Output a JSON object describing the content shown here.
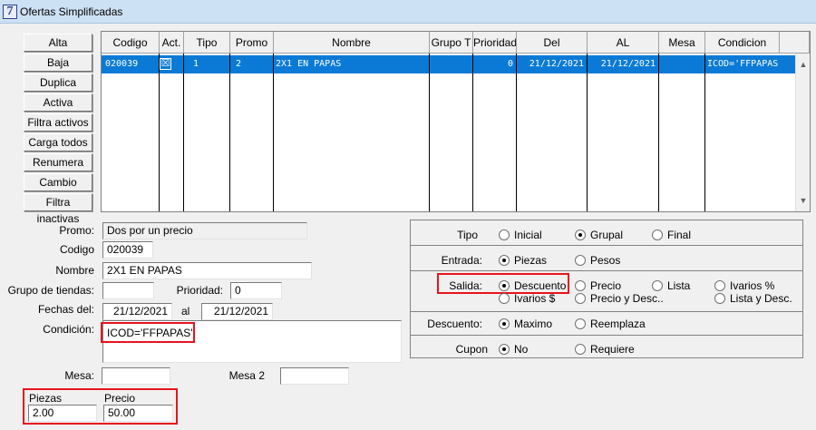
{
  "window": {
    "title": "Ofertas Simplificadas",
    "icon": "7"
  },
  "buttons": [
    "Alta",
    "Baja",
    "Duplica",
    "Activa",
    "Filtra activos",
    "Carga todos",
    "Renumera",
    "Cambio",
    "Filtra inactivas"
  ],
  "grid": {
    "headers": [
      "Codigo",
      "Act.",
      "Tipo",
      "Promo",
      "Nombre",
      "Grupo T",
      "Prioridad",
      "Del",
      "AL",
      "Mesa",
      "Condicion"
    ],
    "row": {
      "codigo": "020039",
      "act": "☒",
      "tipo": "1",
      "promo": "2",
      "nombre": "2X1 EN PAPAS",
      "grupo": "",
      "prioridad": "0",
      "del": "21/12/2021",
      "al": "21/12/2021",
      "mesa": "",
      "condicion": "ICOD='FFPAPAS"
    }
  },
  "form": {
    "promo_label": "Promo:",
    "promo_value": "Dos por un precio",
    "codigo_label": "Codigo",
    "codigo_value": "020039",
    "nombre_label": "Nombre",
    "nombre_value": "2X1 EN PAPAS",
    "grupo_label": "Grupo de tiendas:",
    "grupo_value": "",
    "prioridad_label": "Prioridad:",
    "prioridad_value": "0",
    "fechas_label": "Fechas del:",
    "fecha_del": "21/12/2021",
    "al_label": "al",
    "fecha_al": "21/12/2021",
    "condicion_label": "Condición:",
    "condicion_value": "ICOD='FFPAPAS'",
    "mesa_label": "Mesa:",
    "mesa_value": "",
    "mesa2_label": "Mesa 2",
    "mesa2_value": "",
    "piezas_label": "Piezas",
    "piezas_value": "2.00",
    "precio_label": "Precio",
    "precio_value": "50.00"
  },
  "options": {
    "tipo": {
      "label": "Tipo",
      "items": [
        "Inicial",
        "Grupal",
        "Final"
      ],
      "selected": "Grupal"
    },
    "entrada": {
      "label": "Entrada:",
      "items": [
        "Piezas",
        "Pesos"
      ],
      "selected": "Piezas"
    },
    "salida": {
      "label": "Salida:",
      "items": [
        "Descuento",
        "Precio",
        "Lista",
        "Ivarios %",
        "Ivarios $",
        "Precio y Desc..",
        "Lista y Desc."
      ],
      "selected": "Descuento"
    },
    "descuento": {
      "label": "Descuento:",
      "items": [
        "Maximo",
        "Reemplaza"
      ],
      "selected": "Maximo"
    },
    "cupon": {
      "label": "Cupon",
      "items": [
        "No",
        "Requiere"
      ],
      "selected": "No"
    }
  },
  "colors": {
    "selection": "#0a7ad6",
    "highlight": "#e8141c",
    "titlebar": "#cde1f4"
  }
}
